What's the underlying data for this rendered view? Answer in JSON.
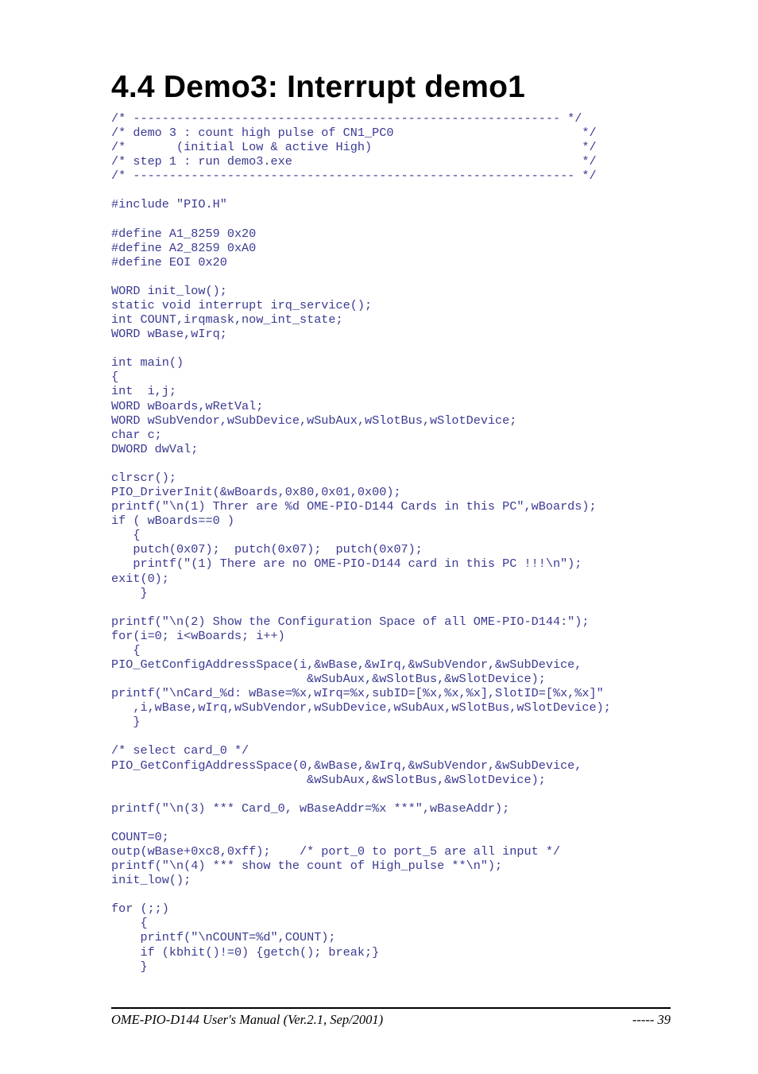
{
  "heading": "4.4   Demo3: Interrupt demo1",
  "code": "/* ----------------------------------------------------------- */\n/* demo 3 : count high pulse of CN1_PC0                          */\n/*       (initial Low & active High)                             */\n/* step 1 : run demo3.exe                                        */\n/* ------------------------------------------------------------- */\n\n#include \"PIO.H\"\n\n#define A1_8259 0x20\n#define A2_8259 0xA0\n#define EOI 0x20\n\nWORD init_low();\nstatic void interrupt irq_service();\nint COUNT,irqmask,now_int_state;\nWORD wBase,wIrq;\n\nint main()\n{\nint  i,j;\nWORD wBoards,wRetVal;\nWORD wSubVendor,wSubDevice,wSubAux,wSlotBus,wSlotDevice;\nchar c;\nDWORD dwVal;\n\nclrscr();\nPIO_DriverInit(&wBoards,0x80,0x01,0x00);\nprintf(\"\\n(1) Threr are %d OME-PIO-D144 Cards in this PC\",wBoards);\nif ( wBoards==0 )\n   {\n   putch(0x07);  putch(0x07);  putch(0x07);\n   printf(\"(1) There are no OME-PIO-D144 card in this PC !!!\\n\");\nexit(0);\n    }\n\nprintf(\"\\n(2) Show the Configuration Space of all OME-PIO-D144:\");\nfor(i=0; i<wBoards; i++)\n   {\nPIO_GetConfigAddressSpace(i,&wBase,&wIrq,&wSubVendor,&wSubDevice,\n                           &wSubAux,&wSlotBus,&wSlotDevice);\nprintf(\"\\nCard_%d: wBase=%x,wIrq=%x,subID=[%x,%x,%x],SlotID=[%x,%x]\"\n   ,i,wBase,wIrq,wSubVendor,wSubDevice,wSubAux,wSlotBus,wSlotDevice);\n   }\n\n/* select card_0 */\nPIO_GetConfigAddressSpace(0,&wBase,&wIrq,&wSubVendor,&wSubDevice,\n                           &wSubAux,&wSlotBus,&wSlotDevice);\n\nprintf(\"\\n(3) *** Card_0, wBaseAddr=%x ***\",wBaseAddr);\n\nCOUNT=0;\noutp(wBase+0xc8,0xff);    /* port_0 to port_5 are all input */\nprintf(\"\\n(4) *** show the count of High_pulse **\\n\");\ninit_low();\n\nfor (;;)\n    {\n    printf(\"\\nCOUNT=%d\",COUNT);\n    if (kbhit()!=0) {getch(); break;}\n    }",
  "footer": {
    "left": "OME-PIO-D144 User's Manual  (Ver.2.1, Sep/2001)",
    "right": "-----  39"
  }
}
